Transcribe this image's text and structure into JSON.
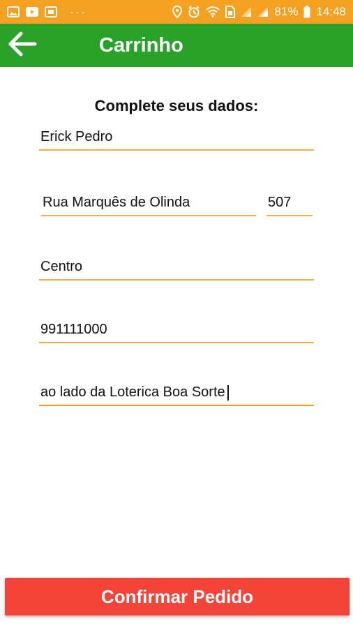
{
  "status_bar": {
    "dots": "···",
    "battery_percent": "81%",
    "time": "14:48",
    "icons_left": [
      "gallery-icon",
      "youtube-icon",
      "video-icon"
    ],
    "icons_right": [
      "location-icon",
      "alarm-icon",
      "wifi-icon",
      "sim-icon",
      "signal-icon",
      "signal-icon",
      "battery-icon"
    ]
  },
  "app_bar": {
    "title": "Carrinho",
    "back_icon": "arrow-left-icon"
  },
  "form": {
    "heading": "Complete seus dados:",
    "name": "Erick Pedro",
    "street": "Rua Marquês de Olinda",
    "number": "507",
    "neighborhood": "Centro",
    "phone": "991111000",
    "reference": "ao lado da Loterica Boa Sorte"
  },
  "actions": {
    "confirm_label": "Confirmar Pedido"
  },
  "colors": {
    "status_bar": "#f4a020",
    "app_bar": "#2aa128",
    "field_underline": "#f0b048",
    "confirm_button": "#f4443a"
  }
}
